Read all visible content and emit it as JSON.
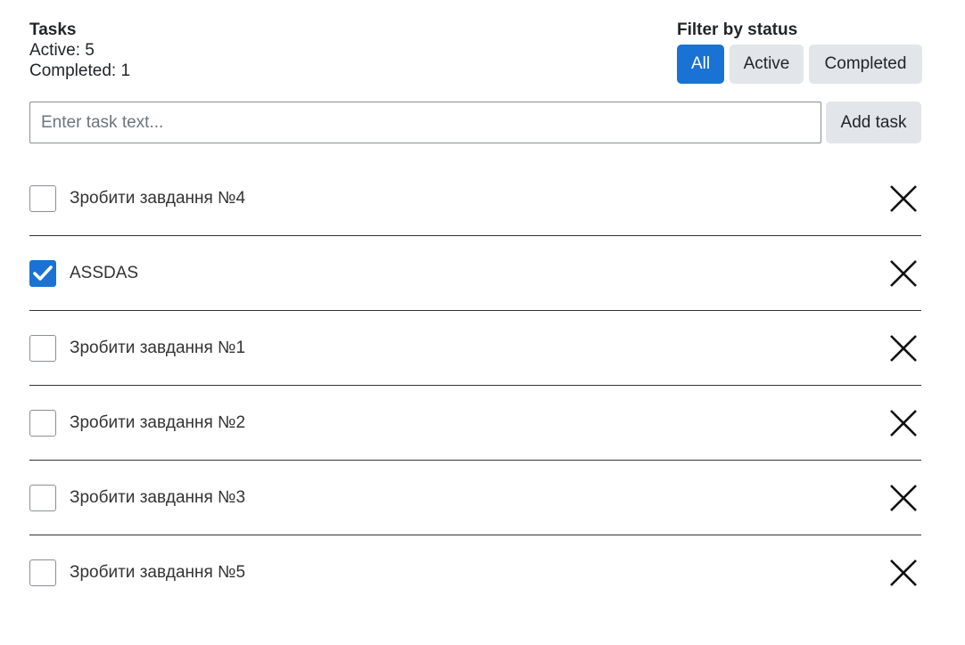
{
  "stats": {
    "title": "Tasks",
    "active": "Active: 5",
    "completed": "Completed: 1"
  },
  "filter": {
    "title": "Filter by status",
    "options": [
      "All",
      "Active",
      "Completed"
    ],
    "selected": "All"
  },
  "add": {
    "placeholder": "Enter task text...",
    "value": "",
    "button_label": "Add task"
  },
  "tasks": [
    {
      "text": "Зробити завдання №4",
      "done": false
    },
    {
      "text": "ASSDAS",
      "done": true
    },
    {
      "text": "Зробити завдання №1",
      "done": false
    },
    {
      "text": "Зробити завдання №2",
      "done": false
    },
    {
      "text": "Зробити завдання №3",
      "done": false
    },
    {
      "text": "Зробити завдання №5",
      "done": false
    }
  ],
  "colors": {
    "accent": "#1a73d4",
    "button_bg": "#e2e6ea",
    "text": "#212529"
  },
  "icons": {
    "check": "check-icon",
    "delete": "close-icon"
  }
}
